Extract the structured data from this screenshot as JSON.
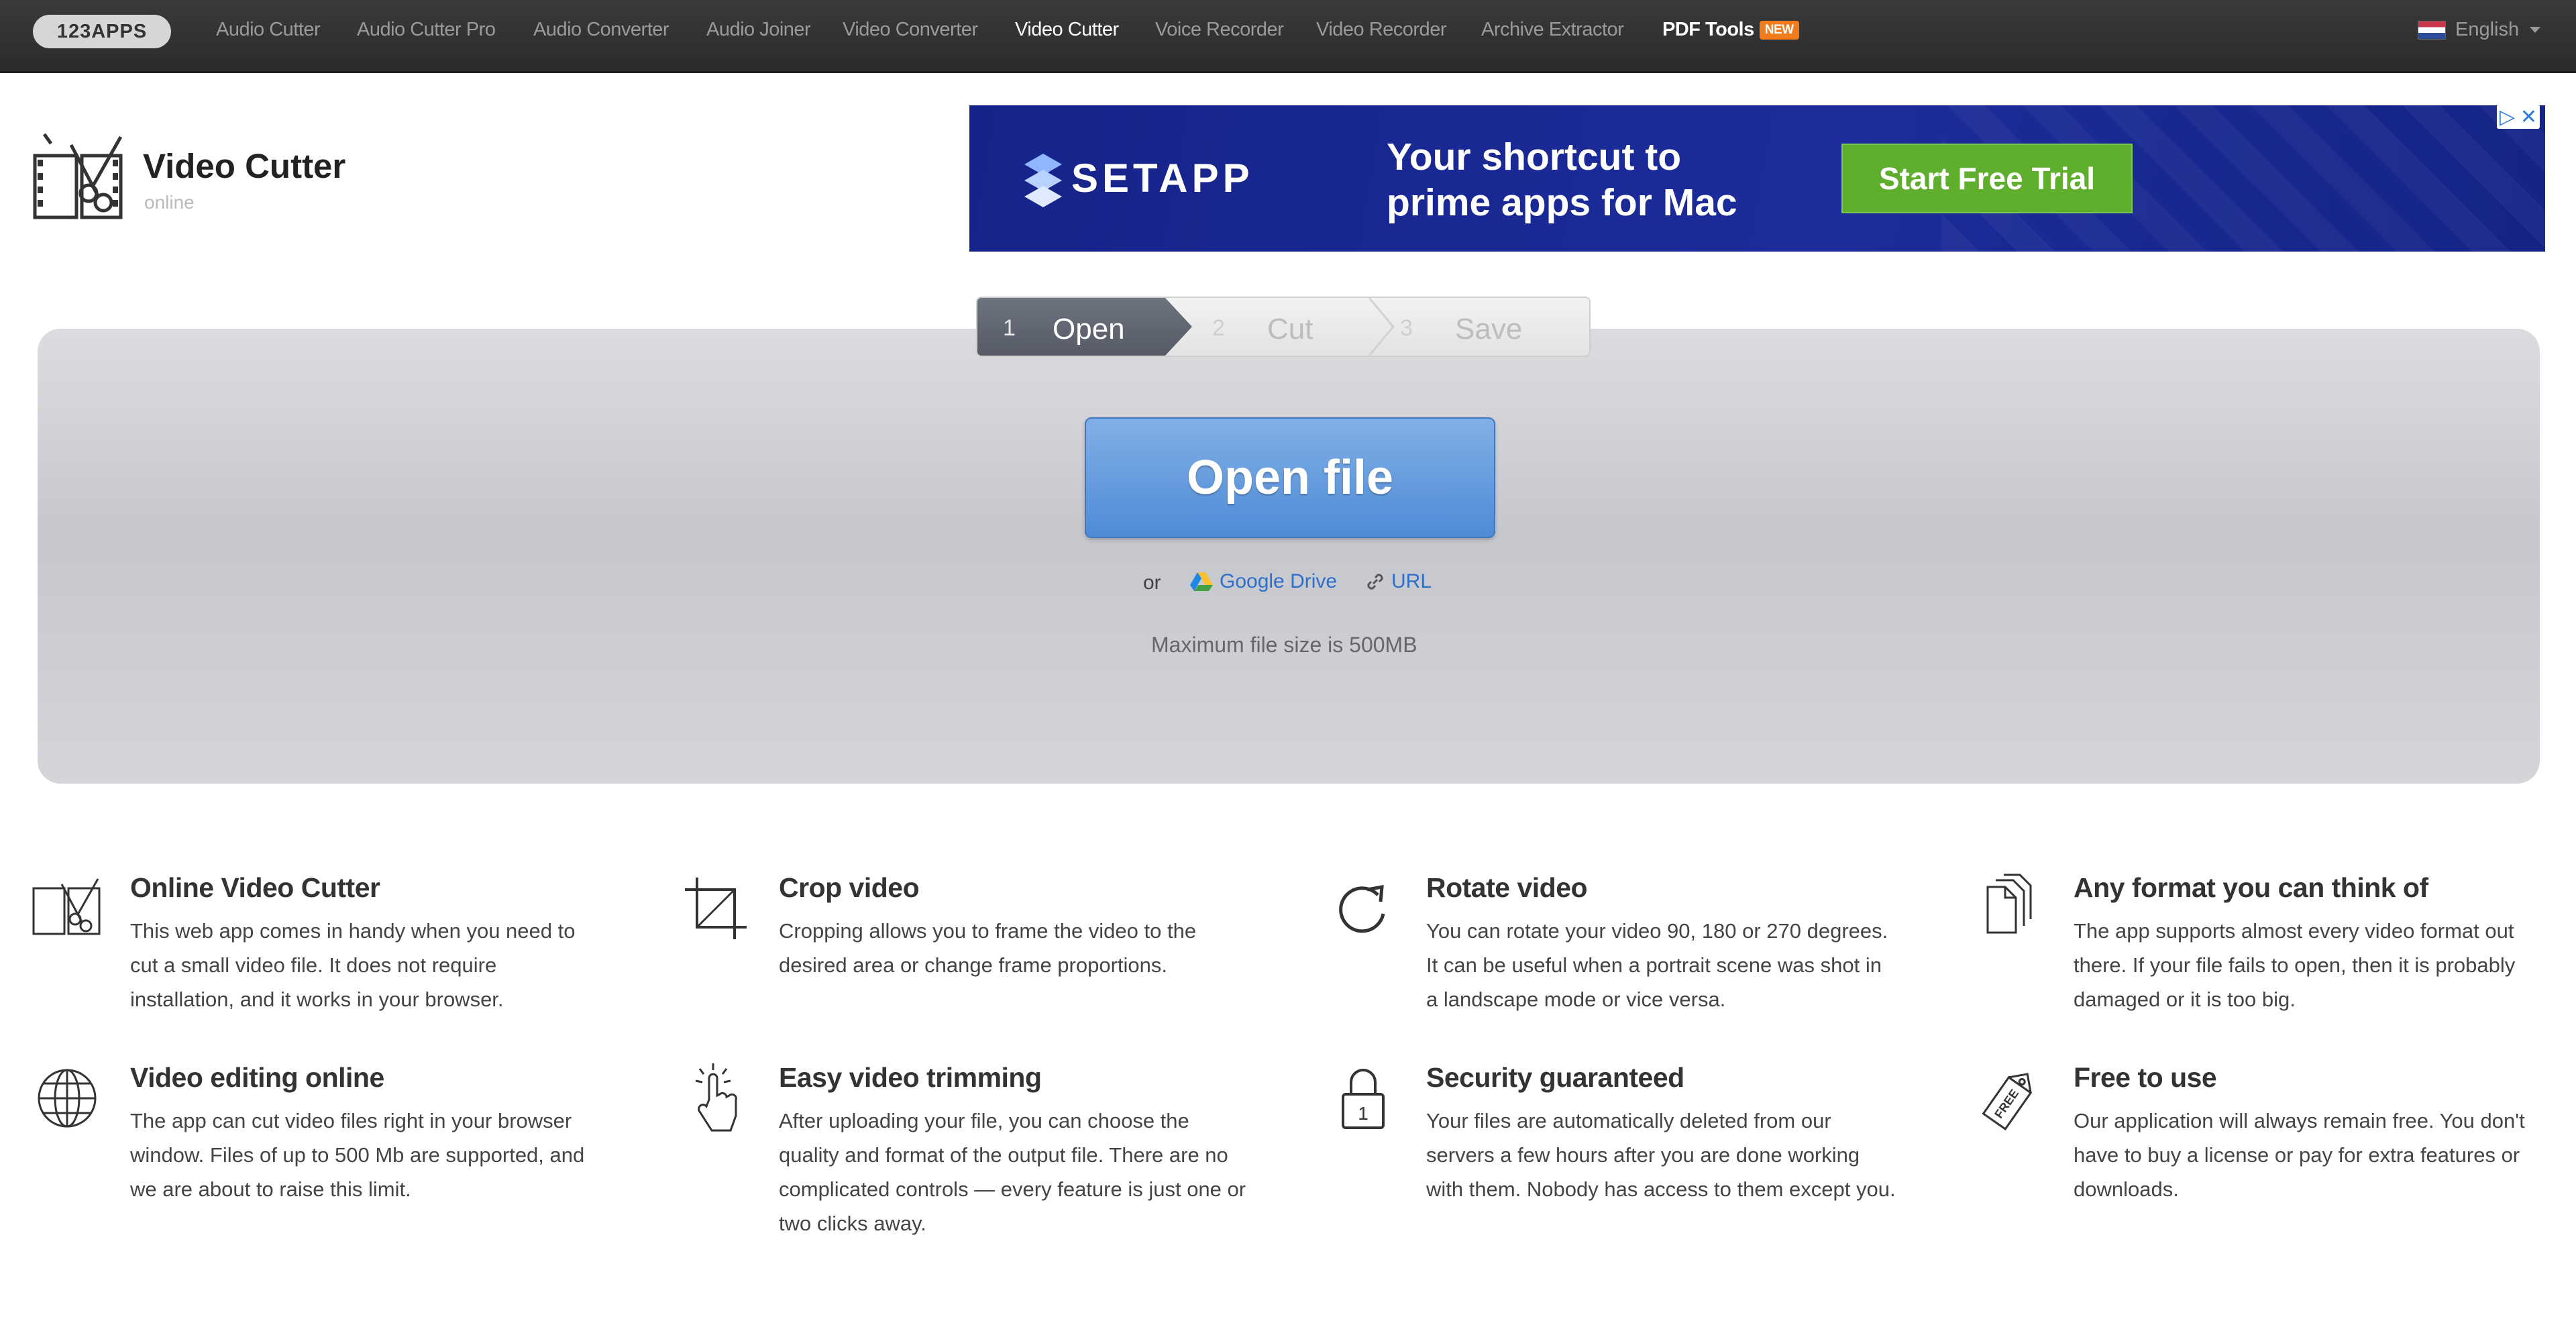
{
  "nav": {
    "brand": "123APPS",
    "links": [
      "Audio Cutter",
      "Audio Cutter Pro",
      "Audio Converter",
      "Audio Joiner",
      "Video Converter",
      "Video Cutter",
      "Voice Recorder",
      "Video Recorder",
      "Archive Extractor",
      "PDF Tools"
    ],
    "active": "Video Cutter",
    "new_badge": "NEW",
    "language": "English"
  },
  "header": {
    "title": "Video Cutter",
    "subtitle": "online"
  },
  "ad": {
    "brand": "SETAPP",
    "line1": "Your shortcut to",
    "line2": "prime apps for Mac",
    "cta": "Start Free Trial",
    "brand_color": "#16238a",
    "cta_color": "#5fae2e"
  },
  "steps": [
    {
      "num": "1",
      "label": "Open"
    },
    {
      "num": "2",
      "label": "Cut"
    },
    {
      "num": "3",
      "label": "Save"
    }
  ],
  "open": {
    "button": "Open file",
    "or": "or",
    "google_drive": "Google Drive",
    "url": "URL",
    "max_size": "Maximum file size is 500MB",
    "button_color": "#4e8bd6"
  },
  "features": [
    {
      "icon": "film-scissors-icon",
      "title": "Online Video Cutter",
      "desc": "This web app comes in handy when you need to cut a small video file. It does not require installation, and it works in your browser."
    },
    {
      "icon": "crop-icon",
      "title": "Crop video",
      "desc": "Cropping allows you to frame the video to the desired area or change frame proportions."
    },
    {
      "icon": "rotate-icon",
      "title": "Rotate video",
      "desc": "You can rotate your video 90, 180 or 270 degrees. It can be useful when a portrait scene was shot in a landscape mode or vice versa."
    },
    {
      "icon": "documents-icon",
      "title": "Any format you can think of",
      "desc": "The app supports almost every video format out there. If your file fails to open, then it is probably damaged or it is too big."
    },
    {
      "icon": "globe-icon",
      "title": "Video editing online",
      "desc": "The app can cut video files right in your browser window. Files of up to 500 Mb are supported, and we are about to raise this limit."
    },
    {
      "icon": "tap-hand-icon",
      "title": "Easy video trimming",
      "desc": "After uploading your file, you can choose the quality and format of the output file. There are no complicated controls — every feature is just one or two clicks away."
    },
    {
      "icon": "padlock-icon",
      "title": "Security guaranteed",
      "desc": "Your files are automatically deleted from our servers a few hours after you are done working with them. Nobody has access to them except you."
    },
    {
      "icon": "free-tag-icon",
      "title": "Free to use",
      "desc": "Our application will always remain free. You don't have to buy a license or pay for extra features or downloads."
    }
  ]
}
